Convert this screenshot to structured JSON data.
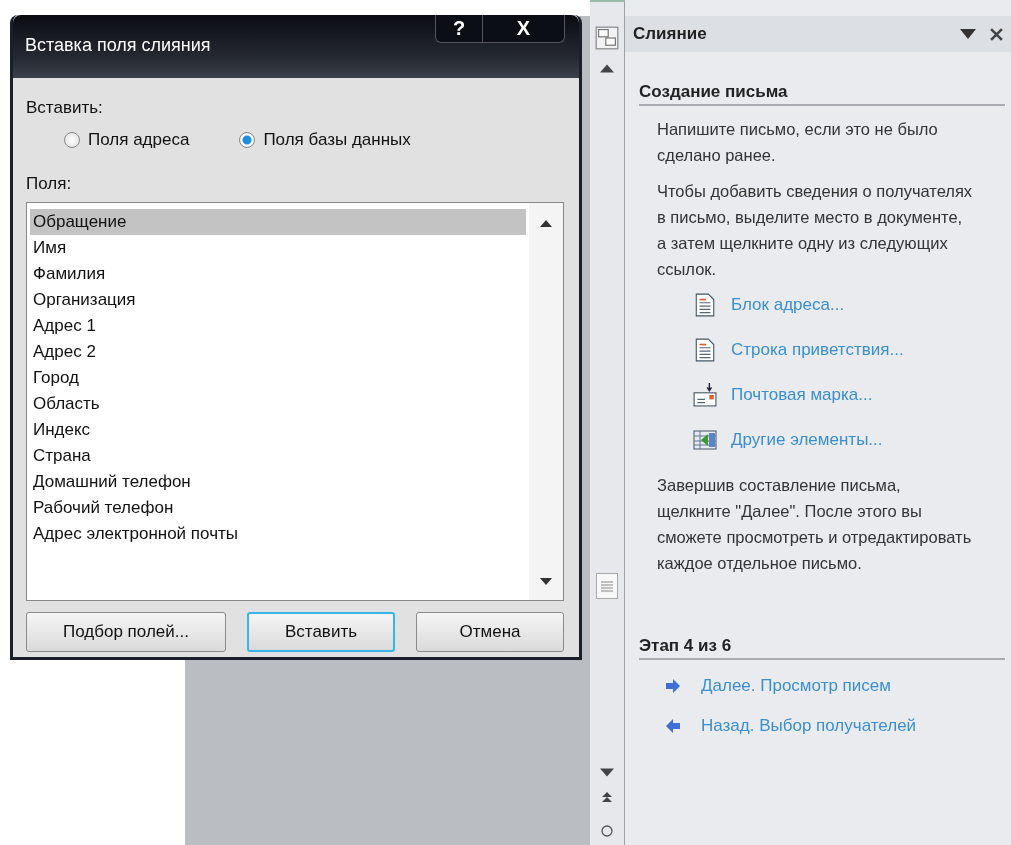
{
  "dialog": {
    "title": "Вставка поля слияния",
    "help_button": "?",
    "close_button": "X",
    "insert_label": "Вставить:",
    "options": [
      {
        "label": "Поля адреса",
        "selected": false
      },
      {
        "label": "Поля базы данных",
        "selected": true
      }
    ],
    "fields_label": "Поля:",
    "fields": [
      {
        "label": "Обращение",
        "selected": true
      },
      {
        "label": "Имя",
        "selected": false
      },
      {
        "label": "Фамилия",
        "selected": false
      },
      {
        "label": "Организация",
        "selected": false
      },
      {
        "label": "Адрес 1",
        "selected": false
      },
      {
        "label": "Адрес 2",
        "selected": false
      },
      {
        "label": "Город",
        "selected": false
      },
      {
        "label": "Область",
        "selected": false
      },
      {
        "label": "Индекс",
        "selected": false
      },
      {
        "label": "Страна",
        "selected": false
      },
      {
        "label": "Домашний телефон",
        "selected": false
      },
      {
        "label": "Рабочий телефон",
        "selected": false
      },
      {
        "label": "Адрес электронной почты",
        "selected": false
      }
    ],
    "buttons": [
      {
        "label": "Подбор полей...",
        "default": false
      },
      {
        "label": "Вставить",
        "default": true
      },
      {
        "label": "Отмена",
        "default": false
      }
    ]
  },
  "task_pane": {
    "title": "Слияние",
    "section_title": "Создание письма",
    "intro": [
      "Напишите письмо, если это не было сделано ранее.",
      "Чтобы добавить сведения о получателях в письмо, выделите место в документе, а затем щелкните одну из следующих ссылок."
    ],
    "links": [
      {
        "kind": "document",
        "label": "Блок адреса..."
      },
      {
        "kind": "document",
        "label": "Строка приветствия..."
      },
      {
        "kind": "stamp",
        "label": "Почтовая марка..."
      },
      {
        "kind": "table",
        "label": "Другие элементы..."
      }
    ],
    "outro": "Завершив составление письма, щелкните \"Далее\". После этого вы сможете просмотреть и отредактировать каждое отдельное письмо.",
    "step_title": "Этап 4 из 6",
    "nav": [
      {
        "kind": "next",
        "label": "Далее. Просмотр писем"
      },
      {
        "kind": "back",
        "label": "Назад. Выбор получателей"
      }
    ]
  }
}
